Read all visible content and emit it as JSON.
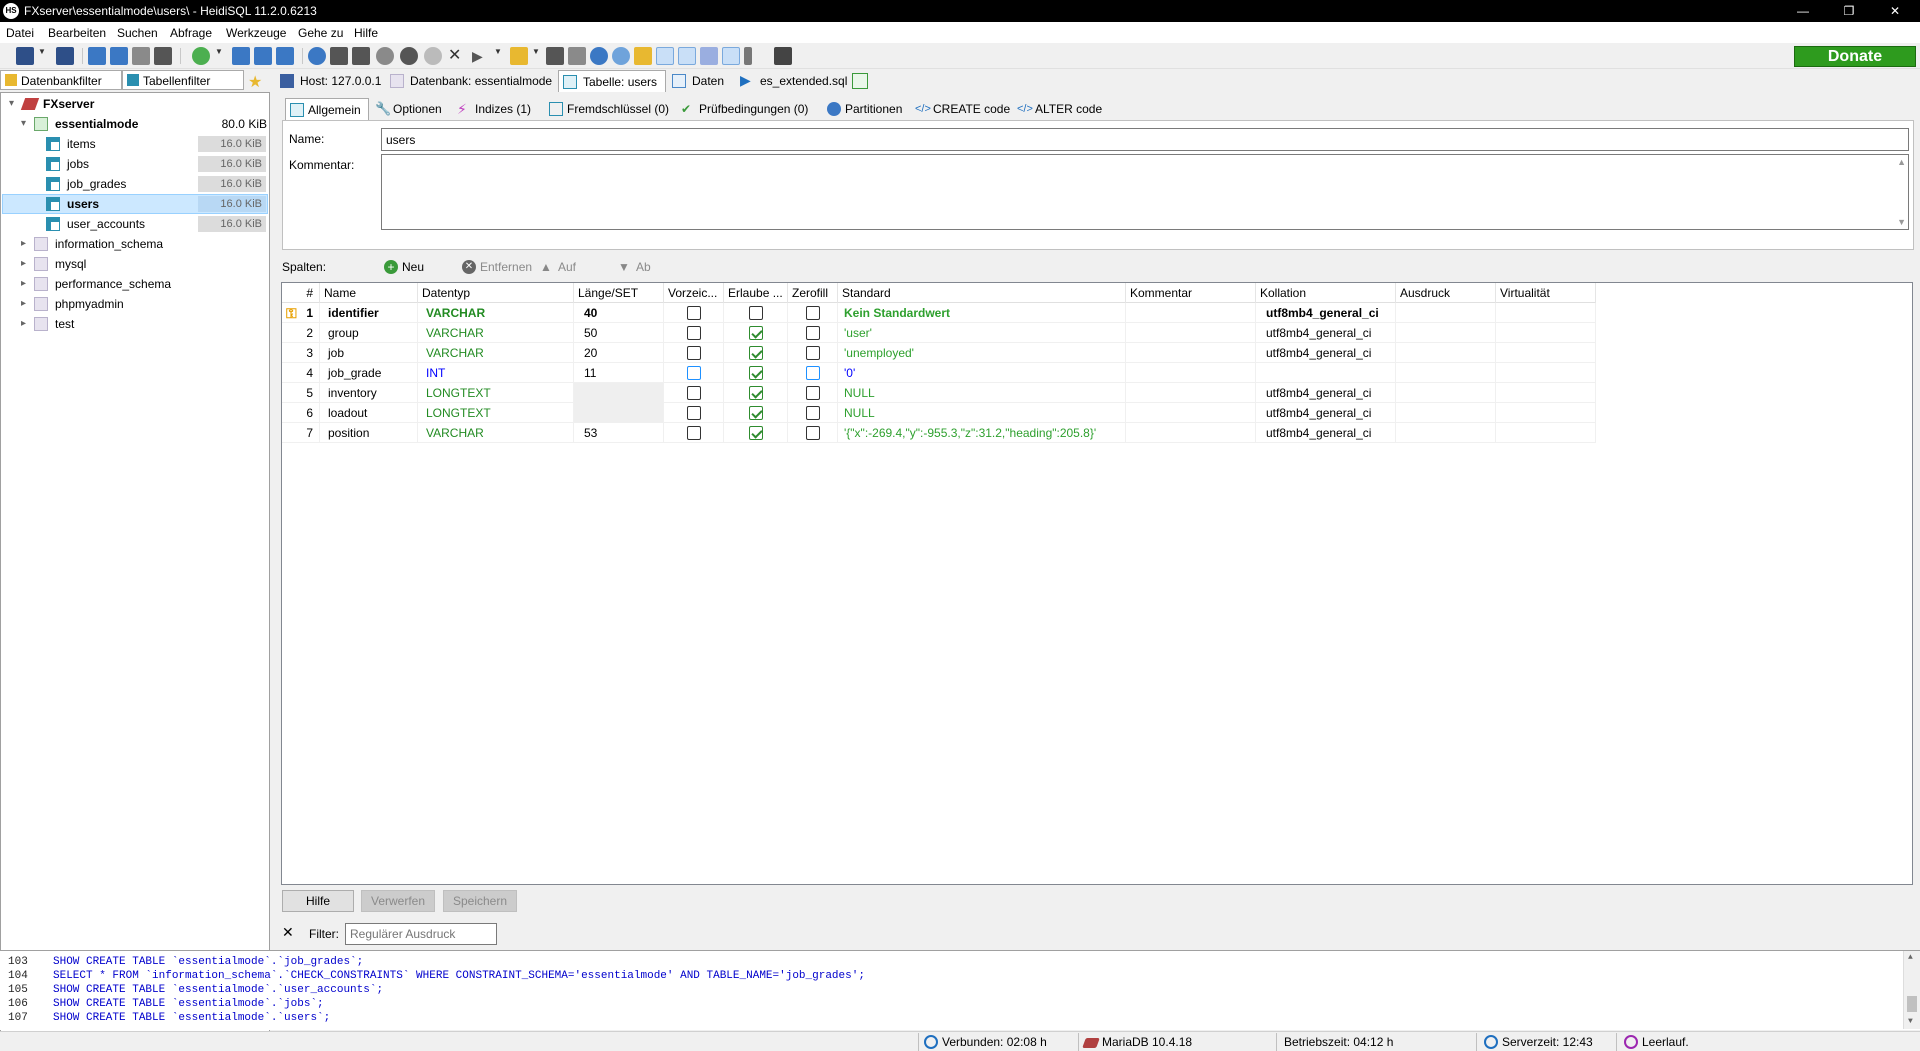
{
  "window": {
    "title": "FXserver\\essentialmode\\users\\ - HeidiSQL 11.2.0.6213",
    "app_icon_text": "HS"
  },
  "menu": [
    "Datei",
    "Bearbeiten",
    "Suchen",
    "Abfrage",
    "Werkzeuge",
    "Gehe zu",
    "Hilfe"
  ],
  "toolbar": {
    "donate_label": "Donate"
  },
  "left_panel": {
    "filter_tabs": [
      "Datenbankfilter",
      "Tabellenfilter"
    ],
    "tree": {
      "server": "FXserver",
      "database": {
        "name": "essentialmode",
        "size": "80.0 KiB"
      },
      "tables": [
        {
          "name": "items",
          "size": "16.0 KiB"
        },
        {
          "name": "jobs",
          "size": "16.0 KiB"
        },
        {
          "name": "job_grades",
          "size": "16.0 KiB"
        },
        {
          "name": "users",
          "size": "16.0 KiB"
        },
        {
          "name": "user_accounts",
          "size": "16.0 KiB"
        }
      ],
      "other_databases": [
        "information_schema",
        "mysql",
        "performance_schema",
        "phpmyadmin",
        "test"
      ]
    }
  },
  "main_tabs": [
    "Host: 127.0.0.1",
    "Datenbank: essentialmode",
    "Tabelle: users",
    "Daten",
    "es_extended.sql"
  ],
  "sub_tabs": [
    "Allgemein",
    "Optionen",
    "Indizes (1)",
    "Fremdschlüssel (0)",
    "Prüfbedingungen (0)",
    "Partitionen",
    "CREATE code",
    "ALTER code"
  ],
  "general": {
    "name_label": "Name:",
    "name_value": "users",
    "comment_label": "Kommentar:"
  },
  "columns_bar": {
    "label": "Spalten:",
    "new": "Neu",
    "remove": "Entfernen",
    "up": "Auf",
    "down": "Ab"
  },
  "grid": {
    "headers": [
      "#",
      "Name",
      "Datentyp",
      "Länge/SET",
      "Vorzeic...",
      "Erlaube ...",
      "Zerofill",
      "Standard",
      "Kommentar",
      "Kollation",
      "Ausdruck",
      "Virtualität"
    ],
    "rows": [
      {
        "num": "1",
        "name": "identifier",
        "type": "VARCHAR",
        "length": "40",
        "unsigned": false,
        "allow_null": false,
        "zerofill": false,
        "default": "Kein Standardwert",
        "comment": "",
        "collation": "utf8mb4_general_ci",
        "expression": "",
        "virtuality": "",
        "bold": true
      },
      {
        "num": "2",
        "name": "group",
        "type": "VARCHAR",
        "length": "50",
        "unsigned": false,
        "allow_null": true,
        "zerofill": false,
        "default": "'user'",
        "comment": "",
        "collation": "utf8mb4_general_ci",
        "expression": "",
        "virtuality": ""
      },
      {
        "num": "3",
        "name": "job",
        "type": "VARCHAR",
        "length": "20",
        "unsigned": false,
        "allow_null": true,
        "zerofill": false,
        "default": "'unemployed'",
        "comment": "",
        "collation": "utf8mb4_general_ci",
        "expression": "",
        "virtuality": ""
      },
      {
        "num": "4",
        "name": "job_grade",
        "type": "INT",
        "length": "11",
        "unsigned": false,
        "allow_null": true,
        "zerofill": false,
        "default": "'0'",
        "comment": "",
        "collation": "",
        "expression": "",
        "virtuality": ""
      },
      {
        "num": "5",
        "name": "inventory",
        "type": "LONGTEXT",
        "length": "",
        "unsigned": false,
        "allow_null": true,
        "zerofill": false,
        "default": "NULL",
        "comment": "",
        "collation": "utf8mb4_general_ci",
        "expression": "",
        "virtuality": ""
      },
      {
        "num": "6",
        "name": "loadout",
        "type": "LONGTEXT",
        "length": "",
        "unsigned": false,
        "allow_null": true,
        "zerofill": false,
        "default": "NULL",
        "comment": "",
        "collation": "utf8mb4_general_ci",
        "expression": "",
        "virtuality": ""
      },
      {
        "num": "7",
        "name": "position",
        "type": "VARCHAR",
        "length": "53",
        "unsigned": false,
        "allow_null": true,
        "zerofill": false,
        "default": "'{\"x\":-269.4,\"y\":-955.3,\"z\":31.2,\"heading\":205.8}'",
        "comment": "",
        "collation": "utf8mb4_general_ci",
        "expression": "",
        "virtuality": ""
      }
    ]
  },
  "buttons": {
    "help": "Hilfe",
    "discard": "Verwerfen",
    "save": "Speichern"
  },
  "filter": {
    "label": "Filter:",
    "placeholder": "Regulärer Ausdruck"
  },
  "log": [
    {
      "num": "103",
      "text": "SHOW CREATE TABLE `essentialmode`.`job_grades`;"
    },
    {
      "num": "104",
      "text": "SELECT * FROM `information_schema`.`CHECK_CONSTRAINTS` WHERE CONSTRAINT_SCHEMA='essentialmode' AND TABLE_NAME='job_grades';"
    },
    {
      "num": "105",
      "text": "SHOW CREATE TABLE `essentialmode`.`user_accounts`;"
    },
    {
      "num": "106",
      "text": "SHOW CREATE TABLE `essentialmode`.`jobs`;"
    },
    {
      "num": "107",
      "text": "SHOW CREATE TABLE `essentialmode`.`users`;"
    }
  ],
  "status": {
    "connected": "Verbunden: 02:08 h",
    "server_version": "MariaDB 10.4.18",
    "uptime": "Betriebszeit: 04:12 h",
    "server_time": "Serverzeit: 12:43",
    "idle": "Leerlauf."
  },
  "colors": {
    "type_varchar": "#228b22",
    "type_int": "#0000ff",
    "type_longtext": "#228b22",
    "default_text": "#2ea02e",
    "selection": "#cce8ff",
    "donate": "#2e9b1e"
  }
}
